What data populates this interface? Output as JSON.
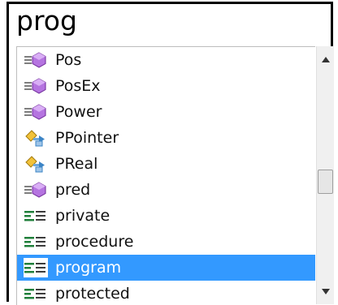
{
  "input": {
    "value": "prog"
  },
  "completion_list": {
    "items": [
      {
        "label": "Pos",
        "icon": "function-icon"
      },
      {
        "label": "PosEx",
        "icon": "function-icon"
      },
      {
        "label": "Power",
        "icon": "function-icon"
      },
      {
        "label": "PPointer",
        "icon": "pointer-type-icon"
      },
      {
        "label": "PReal",
        "icon": "pointer-type-icon"
      },
      {
        "label": "pred",
        "icon": "function-icon"
      },
      {
        "label": "private",
        "icon": "keyword-icon"
      },
      {
        "label": "procedure",
        "icon": "keyword-icon"
      },
      {
        "label": "program",
        "icon": "keyword-icon",
        "selected": true
      },
      {
        "label": "protected",
        "icon": "keyword-icon"
      }
    ]
  },
  "scrollbar": {
    "up_icon": "scroll-up-arrow-icon",
    "down_icon": "scroll-down-arrow-icon"
  },
  "colors": {
    "selection": "#3399ff",
    "keyword_icon": "#1f7f3a",
    "function_icon": "#9b4fc7"
  }
}
